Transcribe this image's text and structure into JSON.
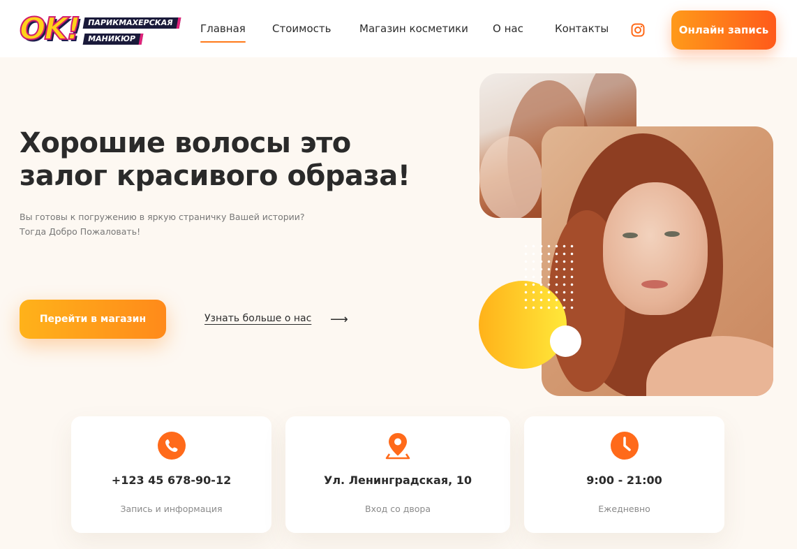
{
  "brand": {
    "logo_main": "OK!",
    "logo_line1": "ПАРИКМАХЕРСКАЯ",
    "logo_line2": "МАНИКЮР"
  },
  "nav": {
    "items": [
      {
        "label": "Главная",
        "active": true
      },
      {
        "label": "Стоимость",
        "active": false
      },
      {
        "label": "Магазин косметики",
        "active": false
      },
      {
        "label": "О нас",
        "active": false
      },
      {
        "label": "Контакты",
        "active": false
      }
    ],
    "social_icon": "instagram-icon",
    "cta_label": "Онлайн запись"
  },
  "hero": {
    "title_line1": "Хорошие волосы это",
    "title_line2": "залог красивого образа!",
    "subtitle_line1": "Вы готовы к погружению в яркую страничку Вашей истории?",
    "subtitle_line2": "Тогда Добро Пожаловать!",
    "primary_button": "Перейти в магазин",
    "secondary_link": "Узнать больше о нас",
    "arrow_icon": "arrow-right-icon"
  },
  "info_cards": [
    {
      "icon": "phone-icon",
      "main": "+123 45 678-90-12",
      "note": "Запись и информация"
    },
    {
      "icon": "location-pin-icon",
      "main": "Ул. Ленинградская, 10",
      "note": "Вход со двора"
    },
    {
      "icon": "clock-icon",
      "main": "9:00 - 21:00",
      "note": "Ежедневно"
    }
  ],
  "colors": {
    "accent_orange": "#ff6a1a",
    "accent_yellow": "#ffb21a",
    "background": "#fdf8f2",
    "text_dark": "#2b2b2b"
  }
}
